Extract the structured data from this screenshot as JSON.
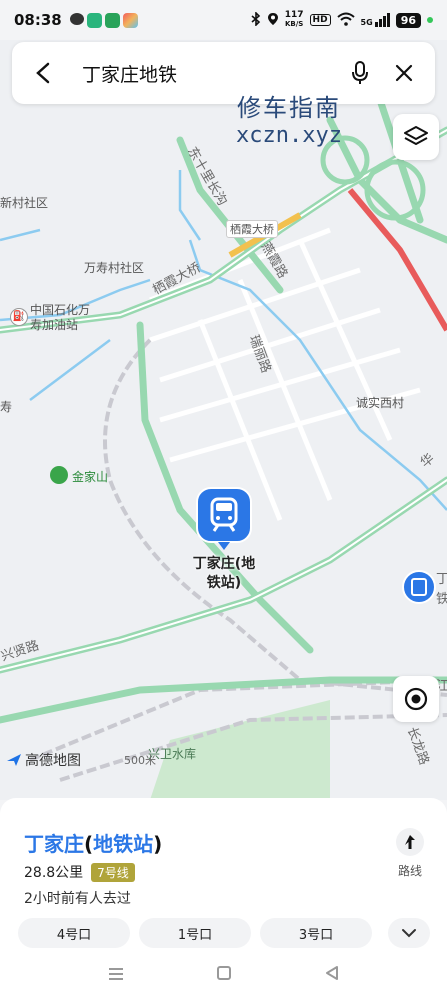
{
  "status_bar": {
    "time": "08:38",
    "net_speed_value": "117",
    "net_speed_unit": "KB/S",
    "hd": "HD",
    "signal": "5G",
    "battery": "96"
  },
  "search": {
    "query": "丁家庄地铁"
  },
  "watermark": {
    "line1": "修车指南",
    "line2": "xczn.xyz"
  },
  "map_labels": {
    "xincun": "新村社区",
    "wanshou": "万寿村社区",
    "sinopec_l1": "中国石化万",
    "sinopec_l2": "寿加油站",
    "shou": "寿",
    "jinjiashan": "金家山",
    "chengshi": "诚实西村",
    "qixia_bridge_tag": "栖霞大桥",
    "qixia_bridge": "栖霞大桥",
    "dongshili": "东十里长沟",
    "yanxia": "燕霞路",
    "ruili": "瑞丽路",
    "xingxian": "兴贤路",
    "xingwei": "兴卫水库",
    "taihua": "华",
    "changlong": "长龙路",
    "ding_right": "丁",
    "zhu_right": "铁",
    "jiang": "江"
  },
  "station": {
    "name": "丁家庄(地铁站)"
  },
  "map_footer": {
    "logo": "高德地图",
    "scale": "500米"
  },
  "sheet": {
    "title_prefix": "丁家庄",
    "title_open": "(",
    "title_mid": "地铁站",
    "title_close": ")",
    "distance": "28.8公里",
    "line": "7号线",
    "visited": "2小时前有人去过",
    "route_label": "路线",
    "exits": [
      "4号口",
      "1号口",
      "3号口"
    ]
  },
  "colors": {
    "accent": "#2b77e6",
    "line7": "#b0a43a",
    "road_green": "#8fd3a8",
    "water": "#7cc4ec"
  }
}
